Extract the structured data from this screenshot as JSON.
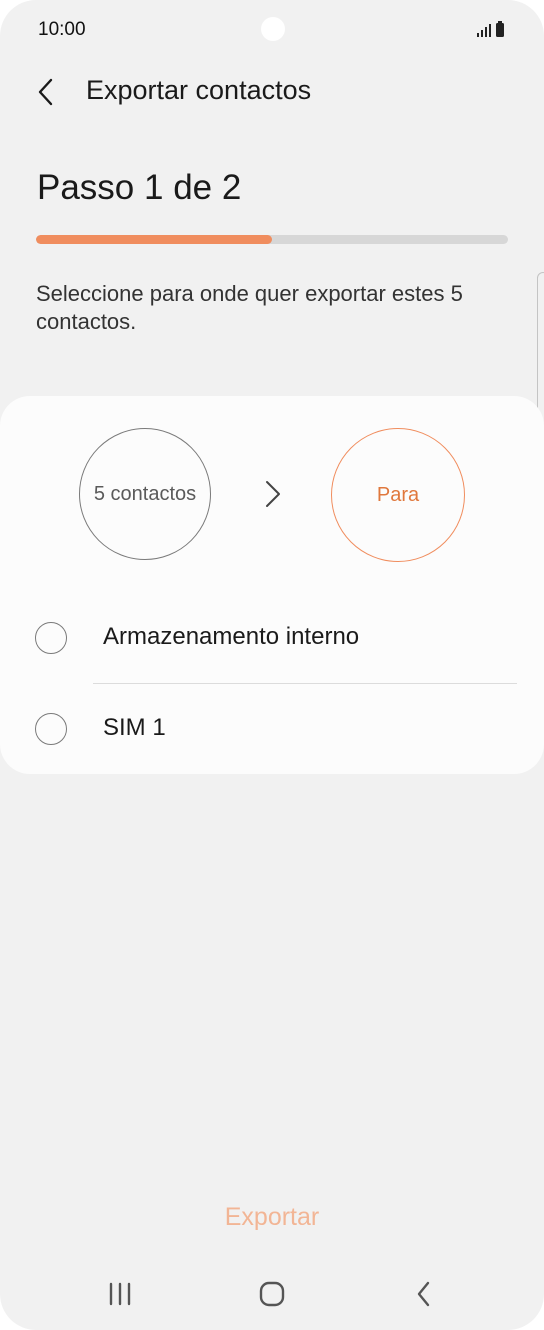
{
  "status_bar": {
    "time": "10:00"
  },
  "header": {
    "title": "Exportar contactos",
    "back_icon": "chevron-left-icon"
  },
  "step": {
    "title": "Passo 1 de 2",
    "progress": 0.5
  },
  "instructions": "Seleccione para onde quer exportar estes 5 contactos.",
  "flow": {
    "source_label": "5 contactos",
    "arrow_icon": "chevron-right-icon",
    "target_label": "Para"
  },
  "options": [
    {
      "label": "Armazenamento interno",
      "selected": false
    },
    {
      "label": "SIM 1",
      "selected": false
    }
  ],
  "actions": {
    "export_label": "Exportar"
  },
  "nav": {
    "recents_icon": "recents-icon",
    "home_icon": "home-icon",
    "back_icon": "back-icon"
  },
  "colors": {
    "accent": "#f08d5e",
    "accent_text": "#e0783d",
    "disabled_accent": "#f2b595",
    "background": "#f1f1f1",
    "card": "#fcfcfc"
  }
}
